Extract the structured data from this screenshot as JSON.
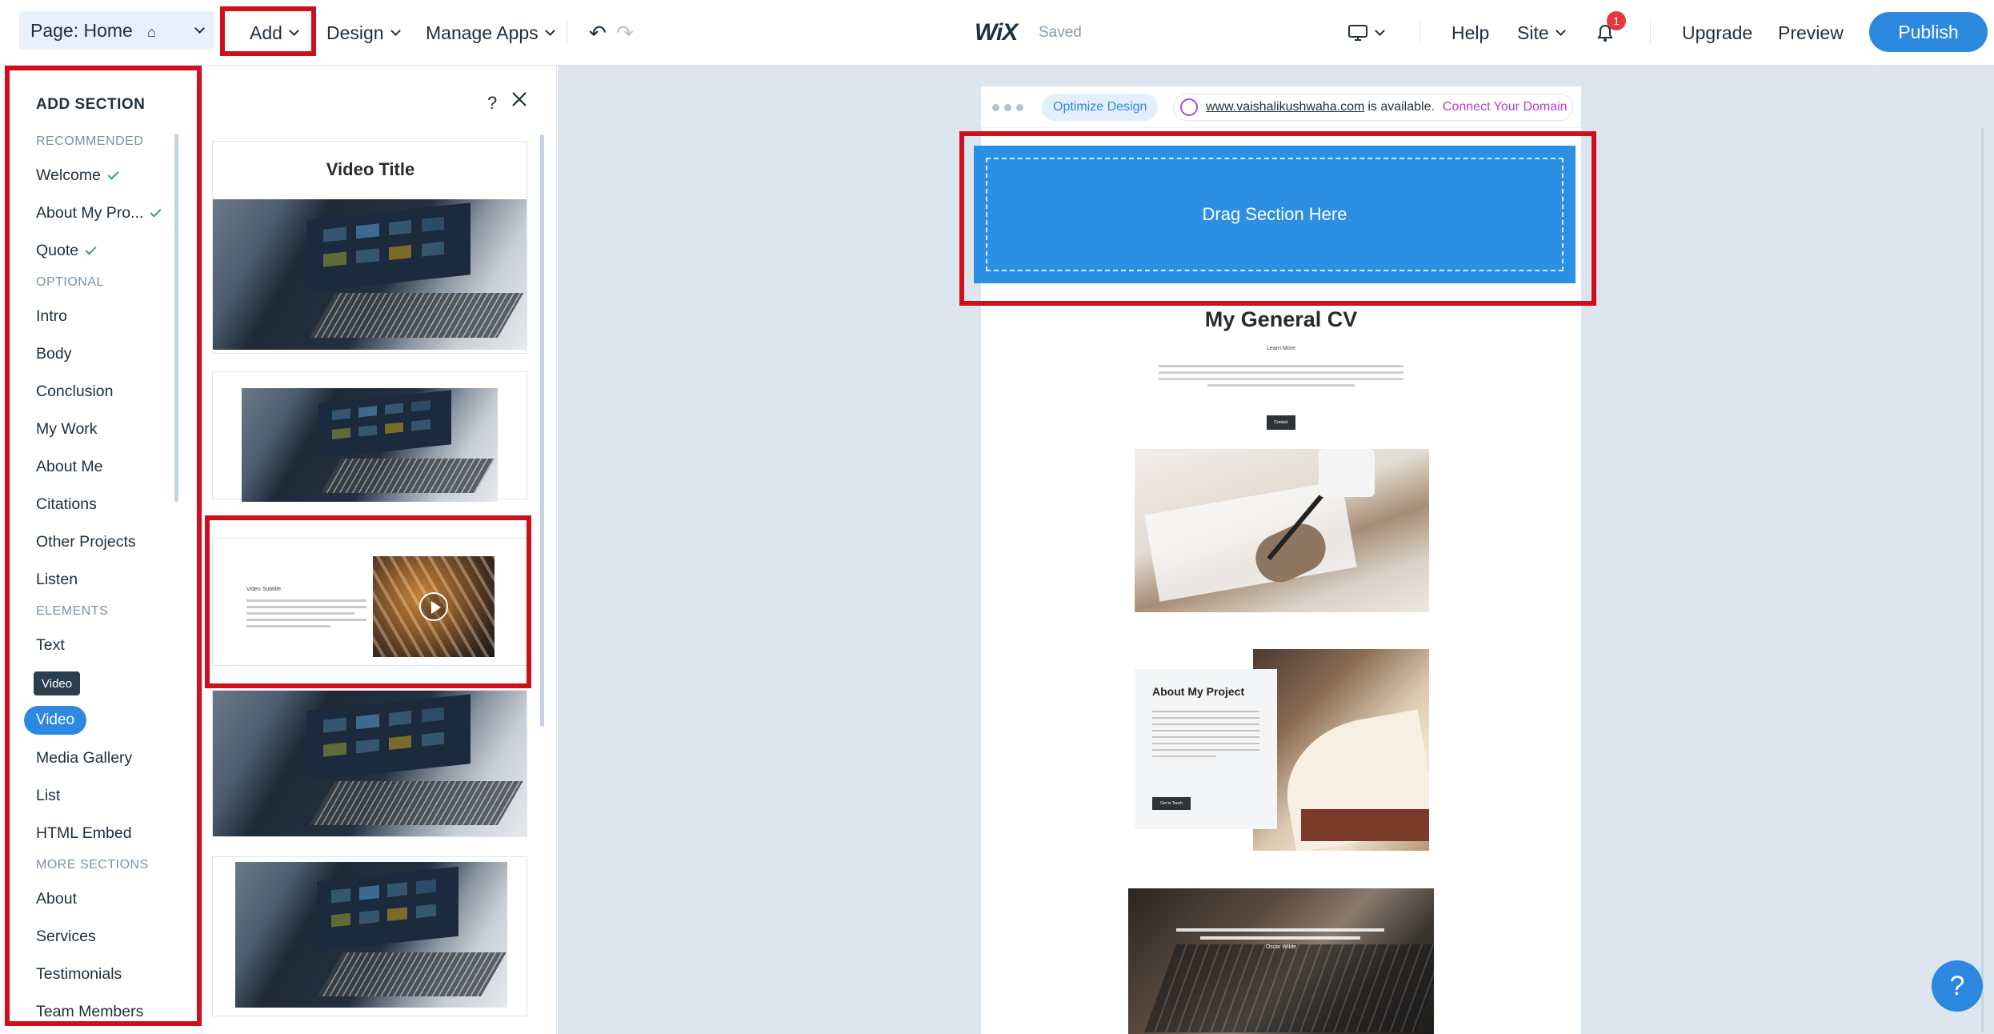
{
  "topbar": {
    "page_label": "Page: Home",
    "menu": {
      "add": "Add",
      "design": "Design",
      "manage_apps": "Manage Apps"
    },
    "logo": "WiX",
    "status": "Saved",
    "help": "Help",
    "site": "Site",
    "notifications_count": "1",
    "upgrade": "Upgrade",
    "preview": "Preview",
    "publish": "Publish"
  },
  "add_section": {
    "title": "ADD SECTION",
    "groups": {
      "recommended": "RECOMMENDED",
      "optional": "OPTIONAL",
      "elements": "ELEMENTS",
      "more": "MORE SECTIONS"
    },
    "recommended_items": [
      "Welcome",
      "About My Pro...",
      "Quote"
    ],
    "optional_items": [
      "Intro",
      "Body",
      "Conclusion",
      "My Work",
      "About Me",
      "Citations",
      "Other Projects",
      "Listen"
    ],
    "element_items": [
      "Text",
      "Video",
      "Media Gallery",
      "List",
      "HTML Embed"
    ],
    "more_items": [
      "About",
      "Services",
      "Testimonials",
      "Team Members"
    ],
    "tooltip": "Video"
  },
  "thumbnails": {
    "help_icon": "?",
    "card1_title": "Video Title",
    "card3_subtitle": "Video Subtitle"
  },
  "site_bar": {
    "optimize": "Optimize Design",
    "domain": "www.vaishalikushwaha.com",
    "available_text": "is available.",
    "connect": "Connect Your Domain"
  },
  "site": {
    "drag_label": "Drag Section Here",
    "heading": "My General CV",
    "learn_more": "Learn More",
    "contact_button": "Contact",
    "project_title": "About My Project",
    "project_button": "Get in Touch",
    "quote_author": "Oscar Wilde"
  },
  "help_bubble": "?",
  "colors": {
    "accent": "#2d88e0",
    "highlight": "#d10f1c",
    "check": "#3aa36b",
    "badge": "#e8383d"
  }
}
